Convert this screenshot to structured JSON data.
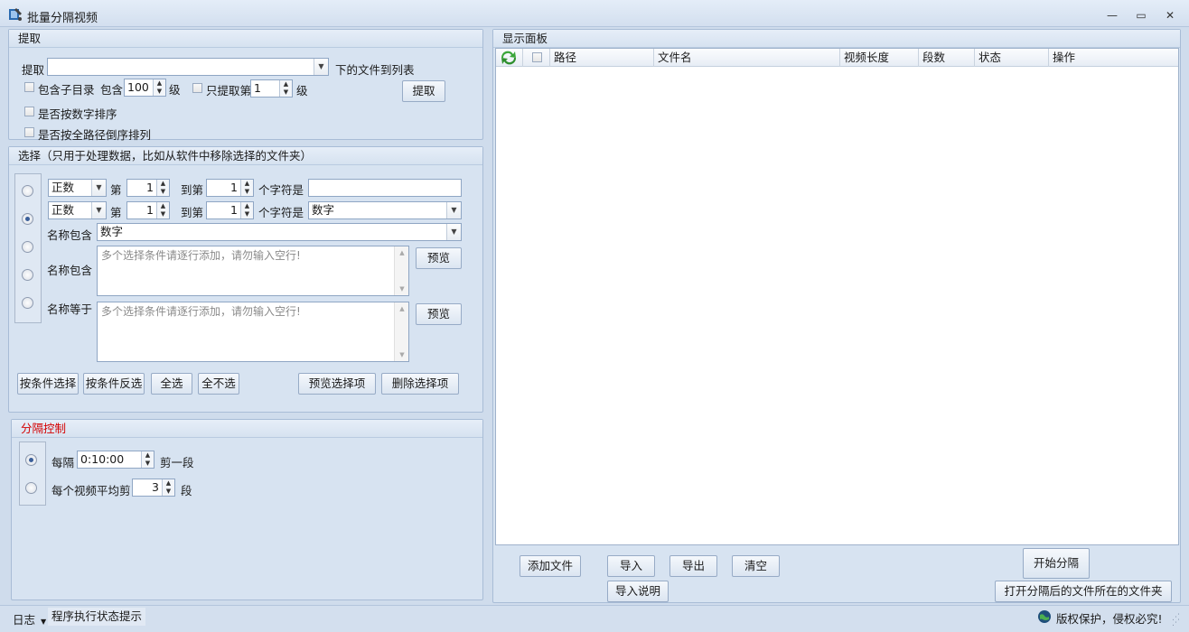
{
  "window": {
    "title": "批量分隔视频",
    "minimize": "—",
    "maximize": "▭",
    "close": "✕"
  },
  "extract": {
    "title": "提取",
    "label": "提取",
    "path_value": "",
    "suffix": "下的文件到列表",
    "include_subdir": "包含子目录",
    "include": "包含",
    "levels_value": "100",
    "level": "级",
    "only_extract": "只提取第",
    "only_value": "1",
    "level2": "级",
    "button": "提取",
    "sort_numeric": "是否按数字排序",
    "sort_path_desc": "是否按全路径倒序排列"
  },
  "select": {
    "title": "选择（只用于处理数据，比如从软件中移除选择的文件夹）",
    "row1": {
      "mode": "正数",
      "di": "第",
      "from": "1",
      "to_label": "到第",
      "to": "1",
      "chars": "个字符是",
      "value": ""
    },
    "row2": {
      "mode": "正数",
      "di": "第",
      "from": "1",
      "to_label": "到第",
      "to": "1",
      "chars": "个字符是",
      "value": "数字"
    },
    "row3": {
      "label": "名称包含",
      "value": "数字"
    },
    "row4": {
      "label": "名称包含",
      "placeholder": "多个选择条件请逐行添加，请勿输入空行!",
      "preview": "预览"
    },
    "row5": {
      "label": "名称等于",
      "placeholder": "多个选择条件请逐行添加，请勿输入空行!",
      "preview": "预览"
    },
    "buttons": {
      "by_condition": "按条件选择",
      "invert": "按条件反选",
      "all": "全选",
      "none": "全不选",
      "preview_sel": "预览选择项",
      "delete_sel": "删除选择项"
    }
  },
  "split": {
    "title": "分隔控制",
    "every": "每隔",
    "every_value": "0:10:00",
    "cut_one": "剪一段",
    "avg": "每个视频平均剪",
    "avg_value": "3",
    "seg": "段",
    "accent": "#d40000"
  },
  "display": {
    "title": "显示面板",
    "columns": [
      "路径",
      "文件名",
      "视频长度",
      "段数",
      "状态",
      "操作"
    ]
  },
  "bottom": {
    "add_file": "添加文件",
    "import": "导入",
    "export": "导出",
    "clear": "清空",
    "start": "开始分隔",
    "import_help": "导入说明",
    "open_folder": "打开分隔后的文件所在的文件夹"
  },
  "status": {
    "log": "日志",
    "hint": "程序执行状态提示",
    "copyright": "版权保护，侵权必究!"
  }
}
